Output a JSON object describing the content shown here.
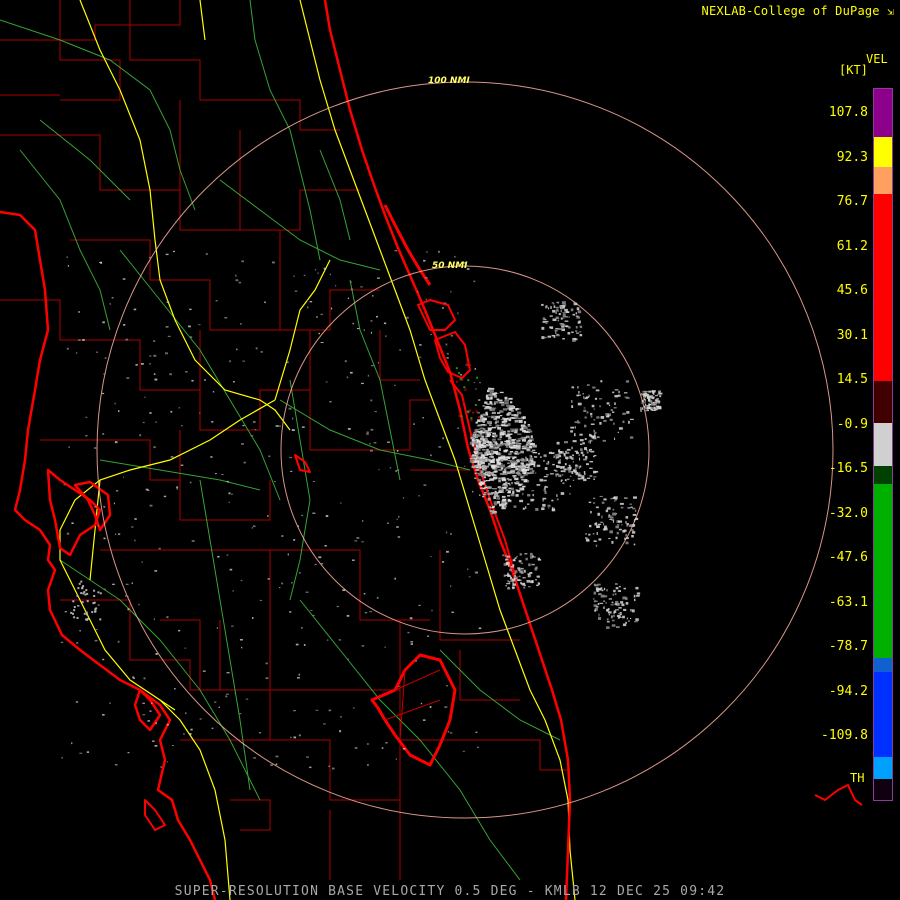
{
  "credit": "NEXLAB-College of DuPage",
  "footer": "SUPER-RESOLUTION BASE VELOCITY 0.5 DEG - KMLB 12 DEC 25 09:42",
  "legend": {
    "variable": "VEL",
    "units": "[KT]",
    "bottom_label": "TH",
    "ticks": [
      "107.8",
      "92.3",
      "76.7",
      "61.2",
      "45.6",
      "30.1",
      "14.5",
      "-0.9",
      "-16.5",
      "-32.0",
      "-47.6",
      "-63.1",
      "-78.7",
      "-94.2",
      "-109.8"
    ],
    "colors": [
      {
        "from": 0.0,
        "to": 0.068,
        "color": "#8c008c"
      },
      {
        "from": 0.068,
        "to": 0.11,
        "color": "#ffff00"
      },
      {
        "from": 0.11,
        "to": 0.148,
        "color": "#ffa060"
      },
      {
        "from": 0.148,
        "to": 0.41,
        "color": "#ff0000"
      },
      {
        "from": 0.41,
        "to": 0.47,
        "color": "#400000"
      },
      {
        "from": 0.47,
        "to": 0.53,
        "color": "#d0d0d0"
      },
      {
        "from": 0.53,
        "to": 0.556,
        "color": "#004000"
      },
      {
        "from": 0.556,
        "to": 0.8,
        "color": "#00b000"
      },
      {
        "from": 0.8,
        "to": 0.82,
        "color": "#1060d0"
      },
      {
        "from": 0.82,
        "to": 0.94,
        "color": "#0030ff"
      },
      {
        "from": 0.94,
        "to": 0.97,
        "color": "#00a0ff"
      },
      {
        "from": 0.97,
        "to": 1.0,
        "color": "#100010"
      }
    ]
  },
  "range_rings": [
    {
      "label": "100 NMI"
    },
    {
      "label": "50 NMI"
    }
  ],
  "colors": {
    "background": "#000000",
    "coastline": "#ff0000",
    "county_lines": "#cc0000",
    "highways": "#ffff00",
    "rivers": "#40c040",
    "range_rings": "#ffb0a0",
    "echoes": "#d0d0d0"
  }
}
